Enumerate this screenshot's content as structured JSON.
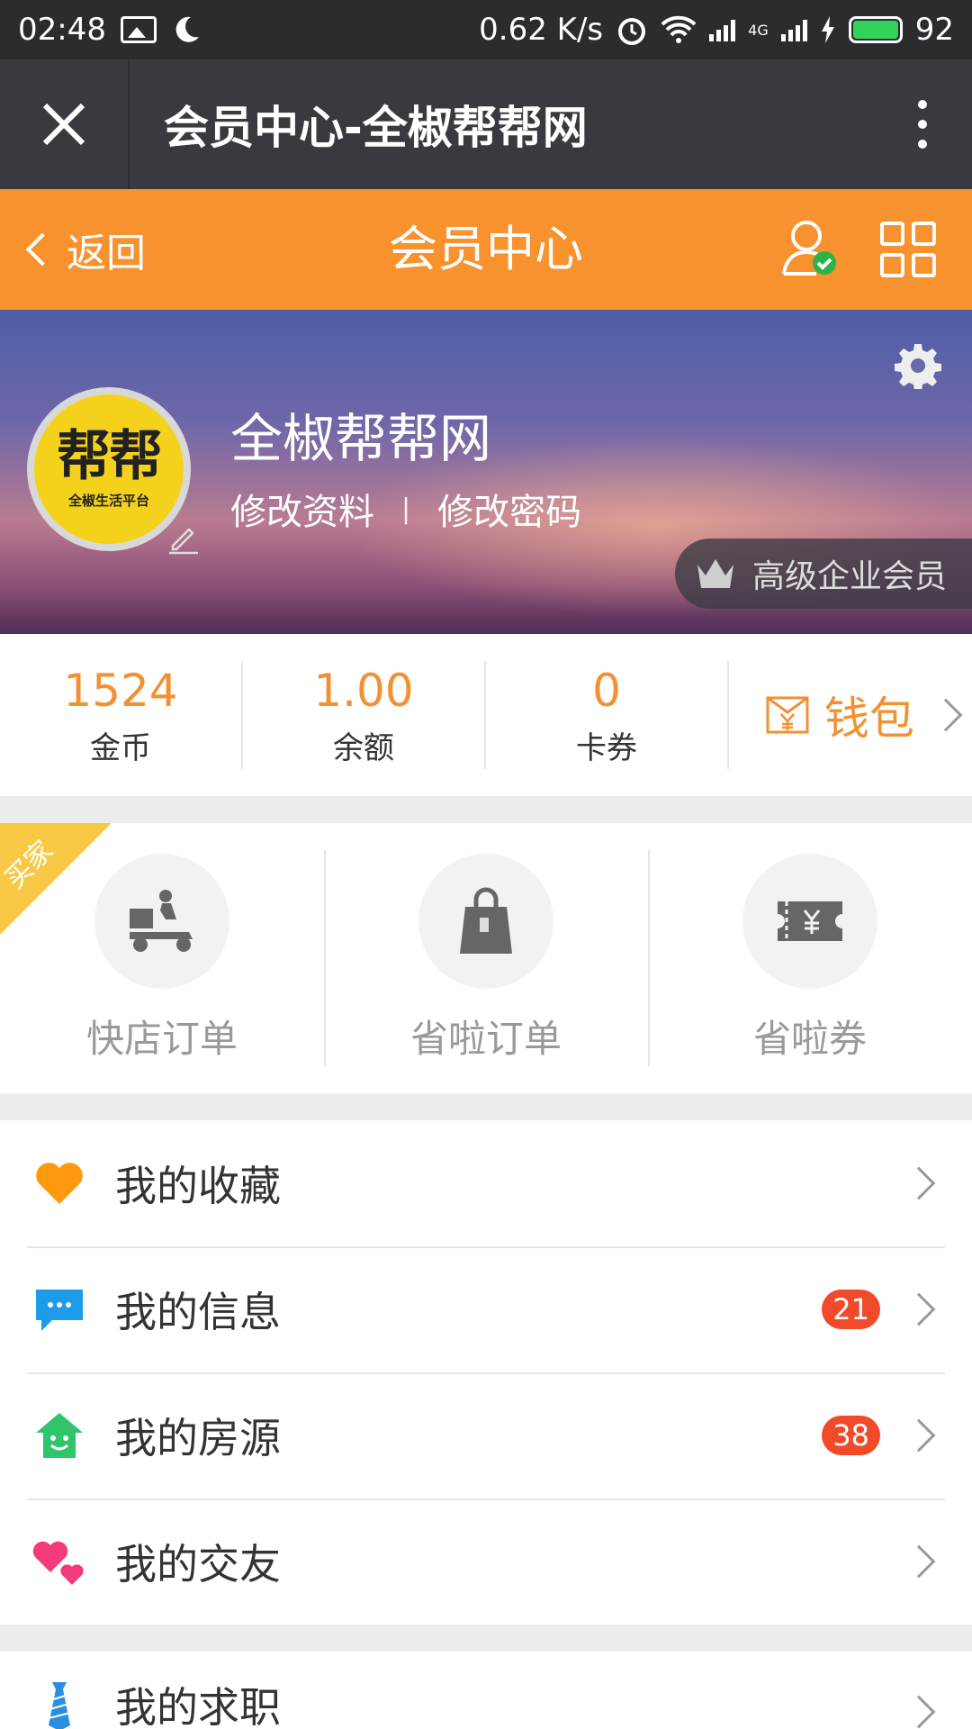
{
  "status_bar": {
    "time": "02:48",
    "net_speed": "0.62 K/s",
    "network": "4G",
    "battery": "92"
  },
  "title_bar": {
    "title": "会员中心-全椒帮帮网"
  },
  "nav_bar": {
    "back_label": "返回",
    "title": "会员中心"
  },
  "profile": {
    "avatar_text": "帮帮",
    "avatar_subtext": "全椒生活平台",
    "name": "全椒帮帮网",
    "edit_profile": "修改资料",
    "separator": "|",
    "change_password": "修改密码",
    "member_level": "高级企业会员"
  },
  "stats": [
    {
      "value": "1524",
      "label": "金币"
    },
    {
      "value": "1.00",
      "label": "余额"
    },
    {
      "value": "0",
      "label": "卡券"
    }
  ],
  "wallet": {
    "label": "钱包"
  },
  "orders": {
    "ribbon": "买家",
    "items": [
      {
        "label": "快店订单",
        "icon": "delivery-scooter-icon"
      },
      {
        "label": "省啦订单",
        "icon": "shopping-bag-icon"
      },
      {
        "label": "省啦券",
        "icon": "coupon-ticket-icon"
      }
    ]
  },
  "menu": [
    {
      "label": "我的收藏",
      "icon": "heart-icon",
      "badge": ""
    },
    {
      "label": "我的信息",
      "icon": "message-bubble-icon",
      "badge": "21"
    },
    {
      "label": "我的房源",
      "icon": "house-icon",
      "badge": "38"
    },
    {
      "label": "我的交友",
      "icon": "double-heart-icon",
      "badge": ""
    }
  ],
  "menu2": [
    {
      "label": "我的求职",
      "icon": "tie-icon"
    }
  ],
  "colors": {
    "orange": "#f7922f",
    "dark_title": "#393a3f",
    "badge_red": "#f04a2a"
  }
}
